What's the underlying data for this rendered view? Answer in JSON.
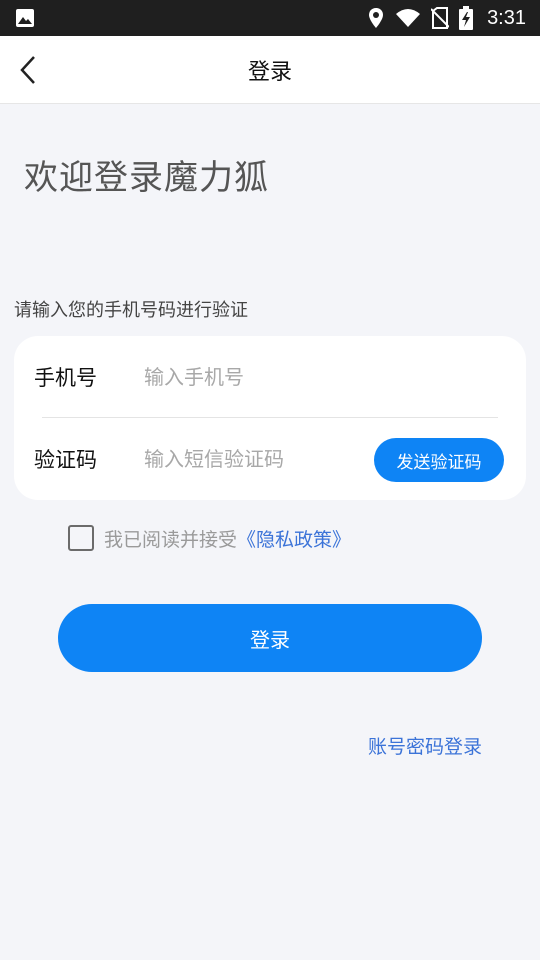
{
  "status_bar": {
    "time": "3:31",
    "icons": [
      "image-icon",
      "location-icon",
      "wifi-icon",
      "no-sim-icon",
      "battery-charging-icon"
    ]
  },
  "app_bar": {
    "title": "登录",
    "back_icon": "chevron-left-icon"
  },
  "welcome_text": "欢迎登录魔力狐",
  "prompt_text": "请输入您的手机号码进行验证",
  "form": {
    "phone": {
      "label": "手机号",
      "placeholder": "输入手机号",
      "value": ""
    },
    "code": {
      "label": "验证码",
      "placeholder": "输入短信验证码",
      "value": ""
    },
    "send_code_label": "发送验证码"
  },
  "agreement": {
    "checked": false,
    "text": "我已阅读并接受",
    "policy_link": "《隐私政策》"
  },
  "login_button": "登录",
  "alt_login_link": "账号密码登录",
  "colors": {
    "accent": "#0e84f5",
    "link": "#3b73d8",
    "background": "#f4f5f9",
    "status_bar": "#1f1f1f"
  }
}
